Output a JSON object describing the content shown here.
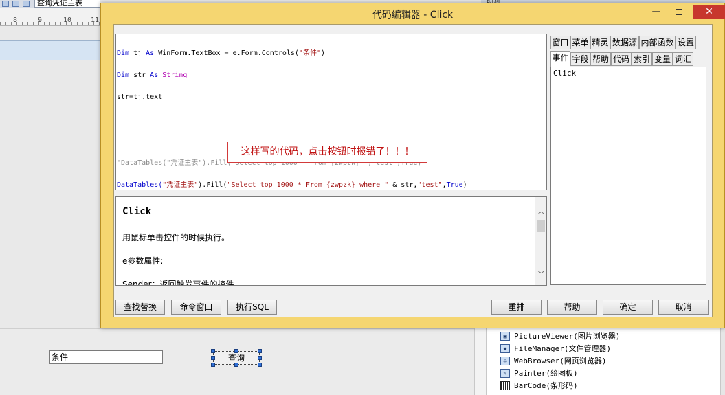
{
  "background": {
    "toolbar_combo": "查询凭证主表",
    "ruler_numbers": [
      "8",
      "9",
      "10",
      "11"
    ],
    "top_right_label": "时件",
    "condition_input": "条件",
    "query_button": "查询",
    "components": [
      {
        "label": "PictureViewer(图片浏览器)",
        "icon": "picture-viewer-icon"
      },
      {
        "label": "FileManager(文件管理器)",
        "icon": "file-manager-icon"
      },
      {
        "label": "WebBrowser(网页浏览器)",
        "icon": "web-browser-icon"
      },
      {
        "label": "Painter(绘图板)",
        "icon": "painter-icon"
      },
      {
        "label": "BarCode(条形码)",
        "icon": "barcode-icon"
      }
    ]
  },
  "dialog": {
    "title": "代码编辑器 - Click",
    "window_controls": {
      "minimize": "—",
      "close": "✕"
    },
    "code": {
      "line1": {
        "k1": "Dim",
        "t1": " tj ",
        "k2": "As",
        "t2": " WinForm.TextBox = e.Form.Controls(",
        "s1": "\"条件\"",
        "t3": ")"
      },
      "line2": {
        "k1": "Dim",
        "t1": " str ",
        "k2": "As",
        "k3": "String"
      },
      "line3": {
        "t1": "str=tj.text"
      },
      "line4": {
        "c1": "'DataTables(\"凭证主表\").Fill(\"Select top 1000 * From {zwpzk} \",\"test\",True)"
      },
      "line5": {
        "t1": "DataTables(",
        "s1": "\"凭证主表\"",
        "t2": ").Fill(",
        "s2": "\"Select top 1000 * From {zwpzk} where \"",
        "t3": " & str,",
        "s3": "\"test\"",
        "t4": ",",
        "k1": "True",
        "t5": ")"
      }
    },
    "error_note": "这样写的代码，点击按钮时报错了！！！",
    "help": {
      "title": "Click",
      "lines": [
        "用鼠标单击控件的时候执行。",
        "e参数属性:",
        "Sender：返回触发事件的控件"
      ]
    },
    "tabs_row1": [
      "窗口",
      "菜单",
      "精灵",
      "数据源",
      "内部函数",
      "设置"
    ],
    "tabs_row2": [
      "事件",
      "字段",
      "帮助",
      "代码",
      "索引",
      "变量",
      "词汇"
    ],
    "active_tab": "事件",
    "event_list": [
      "Click"
    ],
    "buttons_left": [
      "查找替换",
      "命令窗口",
      "执行SQL"
    ],
    "buttons_right": [
      "重排",
      "帮助",
      "确定",
      "取消"
    ]
  }
}
